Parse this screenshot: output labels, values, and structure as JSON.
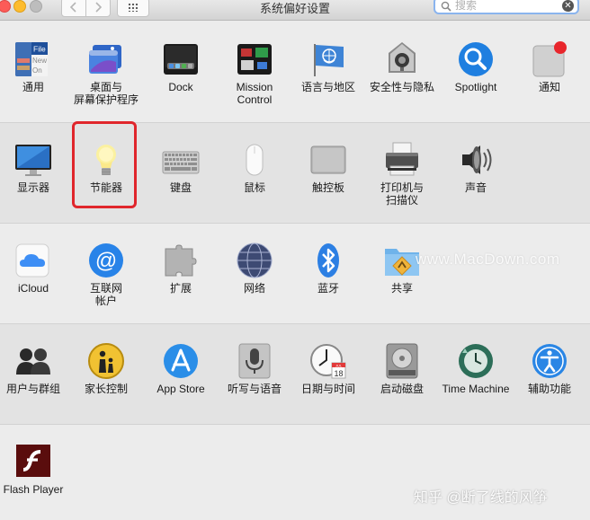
{
  "window": {
    "title": "系统偏好设置",
    "search_placeholder": "搜索",
    "clear_glyph": "✕"
  },
  "rows": [
    [
      {
        "label": "通用",
        "icon": "general-icon"
      },
      {
        "label": "桌面与\n屏幕保护程序",
        "icon": "desktop-screensaver-icon"
      },
      {
        "label": "Dock",
        "icon": "dock-icon"
      },
      {
        "label": "Mission\nControl",
        "icon": "mission-control-icon"
      },
      {
        "label": "语言与地区",
        "icon": "language-region-icon"
      },
      {
        "label": "安全性与隐私",
        "icon": "security-privacy-icon"
      },
      {
        "label": "Spotlight",
        "icon": "spotlight-icon"
      },
      {
        "label": "通知",
        "icon": "notifications-icon"
      }
    ],
    [
      {
        "label": "显示器",
        "icon": "displays-icon"
      },
      {
        "label": "节能器",
        "icon": "energy-saver-icon"
      },
      {
        "label": "键盘",
        "icon": "keyboard-icon"
      },
      {
        "label": "鼠标",
        "icon": "mouse-icon"
      },
      {
        "label": "触控板",
        "icon": "trackpad-icon"
      },
      {
        "label": "打印机与\n扫描仪",
        "icon": "printers-scanners-icon"
      },
      {
        "label": "声音",
        "icon": "sound-icon"
      }
    ],
    [
      {
        "label": "iCloud",
        "icon": "icloud-icon"
      },
      {
        "label": "互联网\n帐户",
        "icon": "internet-accounts-icon"
      },
      {
        "label": "扩展",
        "icon": "extensions-icon"
      },
      {
        "label": "网络",
        "icon": "network-icon"
      },
      {
        "label": "蓝牙",
        "icon": "bluetooth-icon"
      },
      {
        "label": "共享",
        "icon": "sharing-icon"
      }
    ],
    [
      {
        "label": "用户与群组",
        "icon": "users-groups-icon"
      },
      {
        "label": "家长控制",
        "icon": "parental-controls-icon"
      },
      {
        "label": "App Store",
        "icon": "app-store-icon"
      },
      {
        "label": "听写与语音",
        "icon": "dictation-speech-icon"
      },
      {
        "label": "日期与时间",
        "icon": "date-time-icon"
      },
      {
        "label": "启动磁盘",
        "icon": "startup-disk-icon"
      },
      {
        "label": "Time Machine",
        "icon": "time-machine-icon"
      },
      {
        "label": "辅助功能",
        "icon": "accessibility-icon"
      }
    ],
    [
      {
        "label": "Flash Player",
        "icon": "flash-player-icon"
      }
    ]
  ],
  "general_icon_text": [
    "File",
    "New",
    "On"
  ],
  "date_icon_text": {
    "month": "JUL",
    "day": "18"
  },
  "watermark": "www.MacDown.com",
  "credit": "知乎 @断了线的风筝",
  "highlight_color": "#e0262c"
}
